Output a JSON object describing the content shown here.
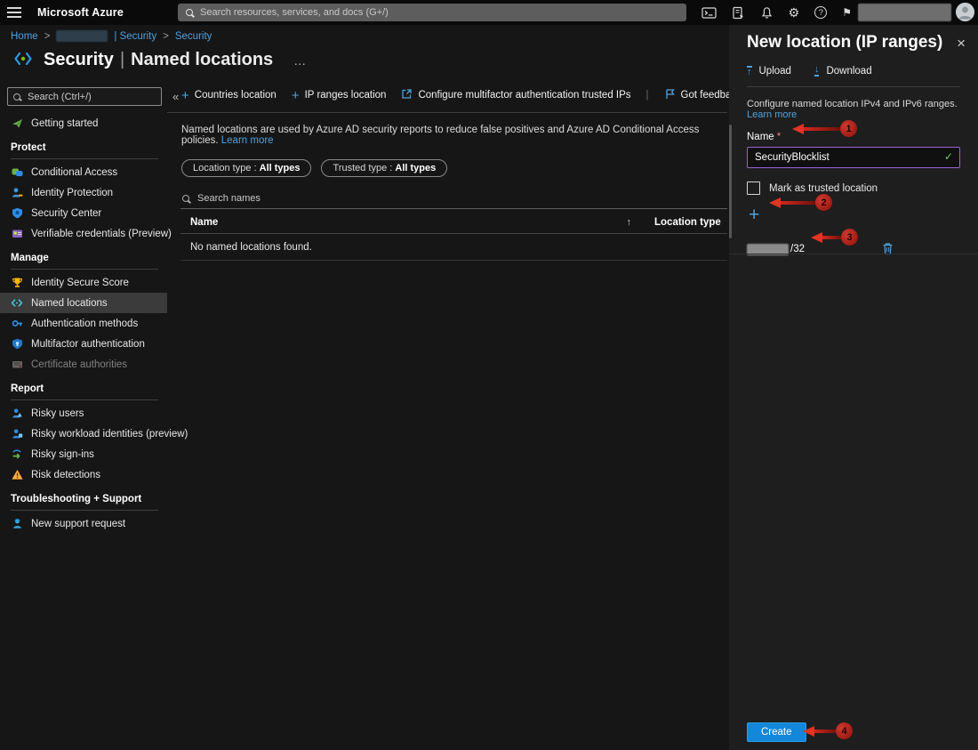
{
  "topbar": {
    "brand": "Microsoft Azure",
    "search_placeholder": "Search resources, services, and docs (G+/)"
  },
  "breadcrumb": {
    "home": "Home",
    "sep": ">",
    "directory_label": "| Security",
    "page": "Security"
  },
  "page": {
    "title_primary": "Security",
    "title_divider": "|",
    "title_secondary": "Named locations"
  },
  "sidebar": {
    "search_placeholder": "Search (Ctrl+/)",
    "groups": [
      {
        "header": "",
        "items": [
          {
            "label": "Getting started"
          }
        ]
      },
      {
        "header": "Protect",
        "items": [
          {
            "label": "Conditional Access"
          },
          {
            "label": "Identity Protection"
          },
          {
            "label": "Security Center"
          },
          {
            "label": "Verifiable credentials (Preview)"
          }
        ]
      },
      {
        "header": "Manage",
        "items": [
          {
            "label": "Identity Secure Score"
          },
          {
            "label": "Named locations"
          },
          {
            "label": "Authentication methods"
          },
          {
            "label": "Multifactor authentication"
          },
          {
            "label": "Certificate authorities"
          }
        ]
      },
      {
        "header": "Report",
        "items": [
          {
            "label": "Risky users"
          },
          {
            "label": "Risky workload identities (preview)"
          },
          {
            "label": "Risky sign-ins"
          },
          {
            "label": "Risk detections"
          }
        ]
      },
      {
        "header": "Troubleshooting + Support",
        "items": [
          {
            "label": "New support request"
          }
        ]
      }
    ]
  },
  "main": {
    "toolbar": {
      "countries": "Countries location",
      "ip_ranges": "IP ranges location",
      "configure_mfa": "Configure multifactor authentication trusted IPs",
      "feedback": "Got feedback?"
    },
    "info_text": "Named locations are used by Azure AD security reports to reduce false positives and Azure AD Conditional Access policies.",
    "info_link": "Learn more",
    "filters": [
      {
        "label": "Location type :",
        "value": "All types"
      },
      {
        "label": "Trusted type :",
        "value": "All types"
      }
    ],
    "search_placeholder": "Search names",
    "table": {
      "columns": [
        "Name",
        "Location type"
      ],
      "empty": "No named locations found."
    }
  },
  "panel": {
    "title": "New location (IP ranges)",
    "toolbar": {
      "upload": "Upload",
      "download": "Download"
    },
    "description": "Configure named location IPv4 and IPv6 ranges.",
    "description_link": "Learn more",
    "name_label": "Name",
    "required": "*",
    "name_value": "SecurityBlocklist",
    "trusted_label": "Mark as trusted location",
    "ip_mask": "/32",
    "create": "Create",
    "annotations": [
      "1",
      "2",
      "3",
      "4"
    ]
  },
  "glyphs": {
    "plus": "+",
    "close": "×",
    "collapse": "«",
    "ellipsis": "…",
    "sort_asc": "↑",
    "gear": "⚙",
    "help": "?",
    "flag": "⚑",
    "check": "✓",
    "up_arrow": "↑",
    "down_arrow": "↓"
  },
  "colors": {
    "accent_blue": "#4da2e0",
    "create_button": "#1387d9",
    "annotation_red": "#e23325",
    "name_input_border": "#9b62d6",
    "valid_check_green": "#6ccb5f"
  }
}
